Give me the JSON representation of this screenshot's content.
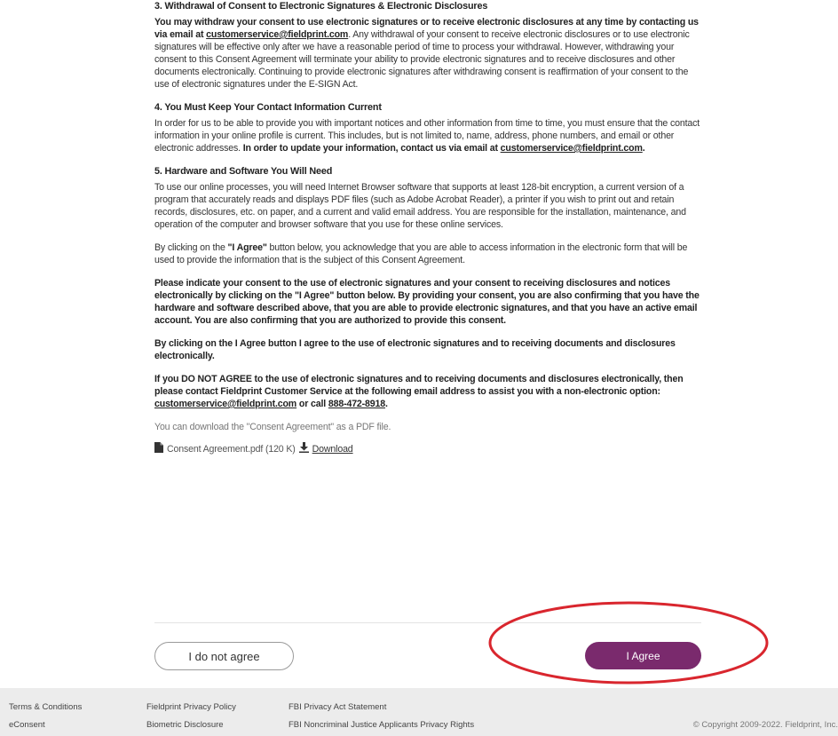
{
  "sections": {
    "s3_title": "3. Withdrawal of Consent to Electronic Signatures & Electronic Disclosures",
    "s3_bold": "You may withdraw your consent to use electronic signatures or to receive electronic disclosures at any time by contacting us via email at ",
    "email": "customerservice@fieldprint.com",
    "s3_rest": ". Any withdrawal of your consent to receive electronic disclosures or to use electronic signatures will be effective only after we have a reasonable period of time to process your withdrawal. However, withdrawing your consent to this Consent Agreement will terminate your ability to provide electronic signatures and to receive disclosures and other documents electronically. Continuing to provide electronic signatures after withdrawing consent is reaffirmation of your consent to the use of electronic signatures under the E-SIGN Act.",
    "s4_title": "4. You Must Keep Your Contact Information Current",
    "s4_text": "In order for us to be able to provide you with important notices and other information from time to time, you must ensure that the contact information in your online profile is current. This includes, but is not limited to, name, address, phone numbers, and email or other electronic addresses. ",
    "s4_bold": "In order to update your information, contact us via email at ",
    "s4_end": ".",
    "s5_title": "5. Hardware and Software You Will Need",
    "s5_text": "To use our online processes, you will need Internet Browser software that supports at least 128-bit encryption, a current version of a program that accurately reads and displays PDF files (such as Adobe Acrobat Reader), a printer if you wish to print out and retain records, disclosures, etc. on paper, and a current and valid email address. You are responsible for the installation, maintenance, and operation of the computer and browser software that you use for these online services.",
    "p_ack_pre": "By clicking on the ",
    "p_ack_bold": "\"I Agree\"",
    "p_ack_post": " button below, you acknowledge that you are able to access information in the electronic form that will be used to provide the information that is the subject of this Consent Agreement.",
    "p_indicate": "Please indicate your consent to the use of electronic signatures and your consent to receiving disclosures and notices electronically by clicking on the \"I Agree\" button below. By providing your consent, you are also confirming that you have the hardware and software described above, that you are able to provide electronic signatures, and that you have an active email account. You are also confirming that you are authorized to provide this consent.",
    "p_agree": "By clicking on the I Agree button I agree to the use of electronic signatures and to receiving documents and disclosures electronically.",
    "p_notagree_pre": "If you DO NOT AGREE to the use of electronic signatures and to receiving documents and disclosures electronically, then please contact Fieldprint Customer Service at the following email address to assist you with a non-electronic option: ",
    "p_notagree_or": " or call ",
    "phone": "888-472-8918",
    "p_notagree_end": "."
  },
  "download": {
    "note": "You can download the \"Consent Agreement\" as a PDF file.",
    "file": "Consent Agreement.pdf (120 K)",
    "link": "Download",
    "icon": "file-icon",
    "dl_icon": "download-arrow-icon"
  },
  "buttons": {
    "disagree": "I do not agree",
    "agree": "I Agree"
  },
  "colors": {
    "primary": "#7a2a6d",
    "annotation": "#d9262e",
    "footer_bg": "#ececec"
  },
  "footer": {
    "terms": "Terms & Conditions",
    "econsent": "eConsent",
    "privacy": "Fieldprint Privacy Policy",
    "biometric": "Biometric Disclosure",
    "fbi_privacy": "FBI Privacy Act Statement",
    "fbi_noncriminal": "FBI Noncriminal Justice Applicants Privacy Rights",
    "copyright": "© Copyright 2009-2022. Fieldprint, Inc."
  }
}
